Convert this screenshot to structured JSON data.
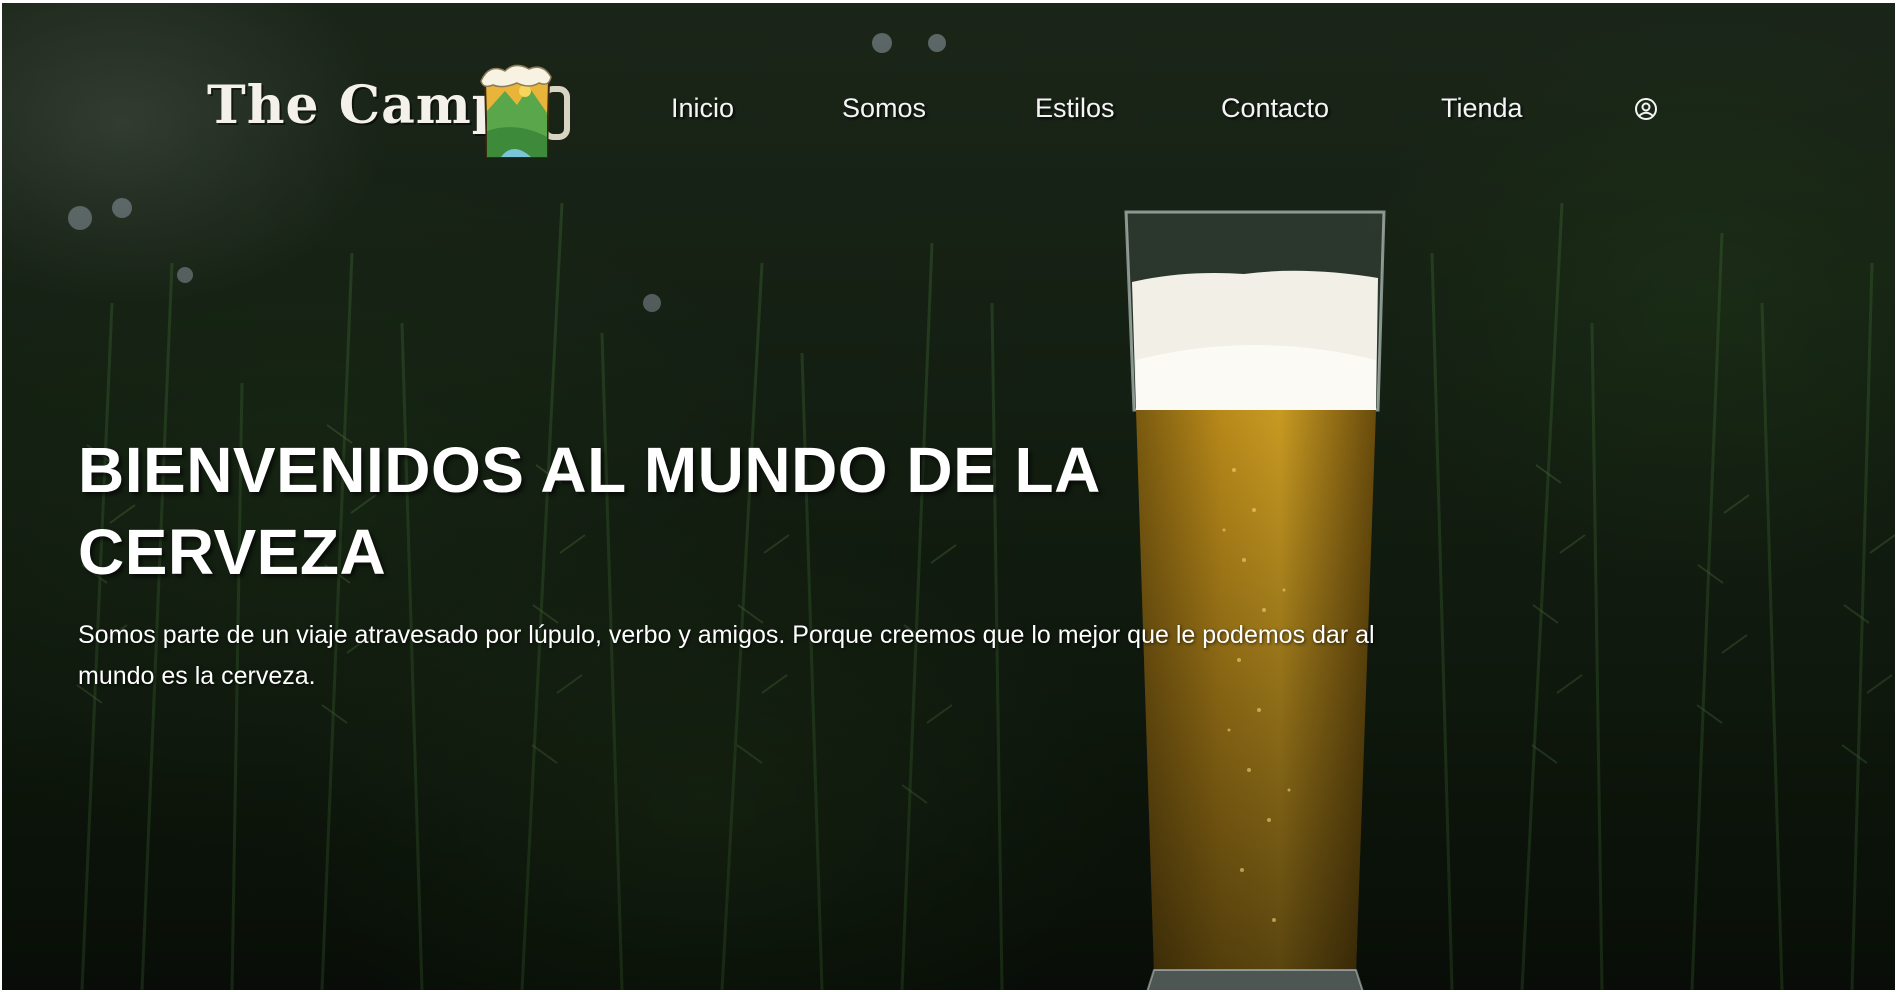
{
  "brand": {
    "name": "The Camp",
    "logo_icon": "beer-mug-mountain-icon"
  },
  "nav": {
    "items": [
      {
        "label": "Inicio"
      },
      {
        "label": "Somos"
      },
      {
        "label": "Estilos"
      },
      {
        "label": "Contacto"
      },
      {
        "label": "Tienda"
      }
    ],
    "account_icon": "user-circle-icon"
  },
  "hero": {
    "title": "BIENVENIDOS AL MUNDO DE LA CERVEZA",
    "subtitle": "Somos parte de un viaje atravesado por lúpulo, verbo y amigos. Porque creemos que lo mejor que le podemos dar al mundo es la cerveza.",
    "background": "rosemary-bushes-with-beer-glass",
    "overlay_color": "#1b2a18"
  },
  "colors": {
    "text": "#ffffff",
    "beer": "#b8891a",
    "foam": "#f2efe6"
  }
}
